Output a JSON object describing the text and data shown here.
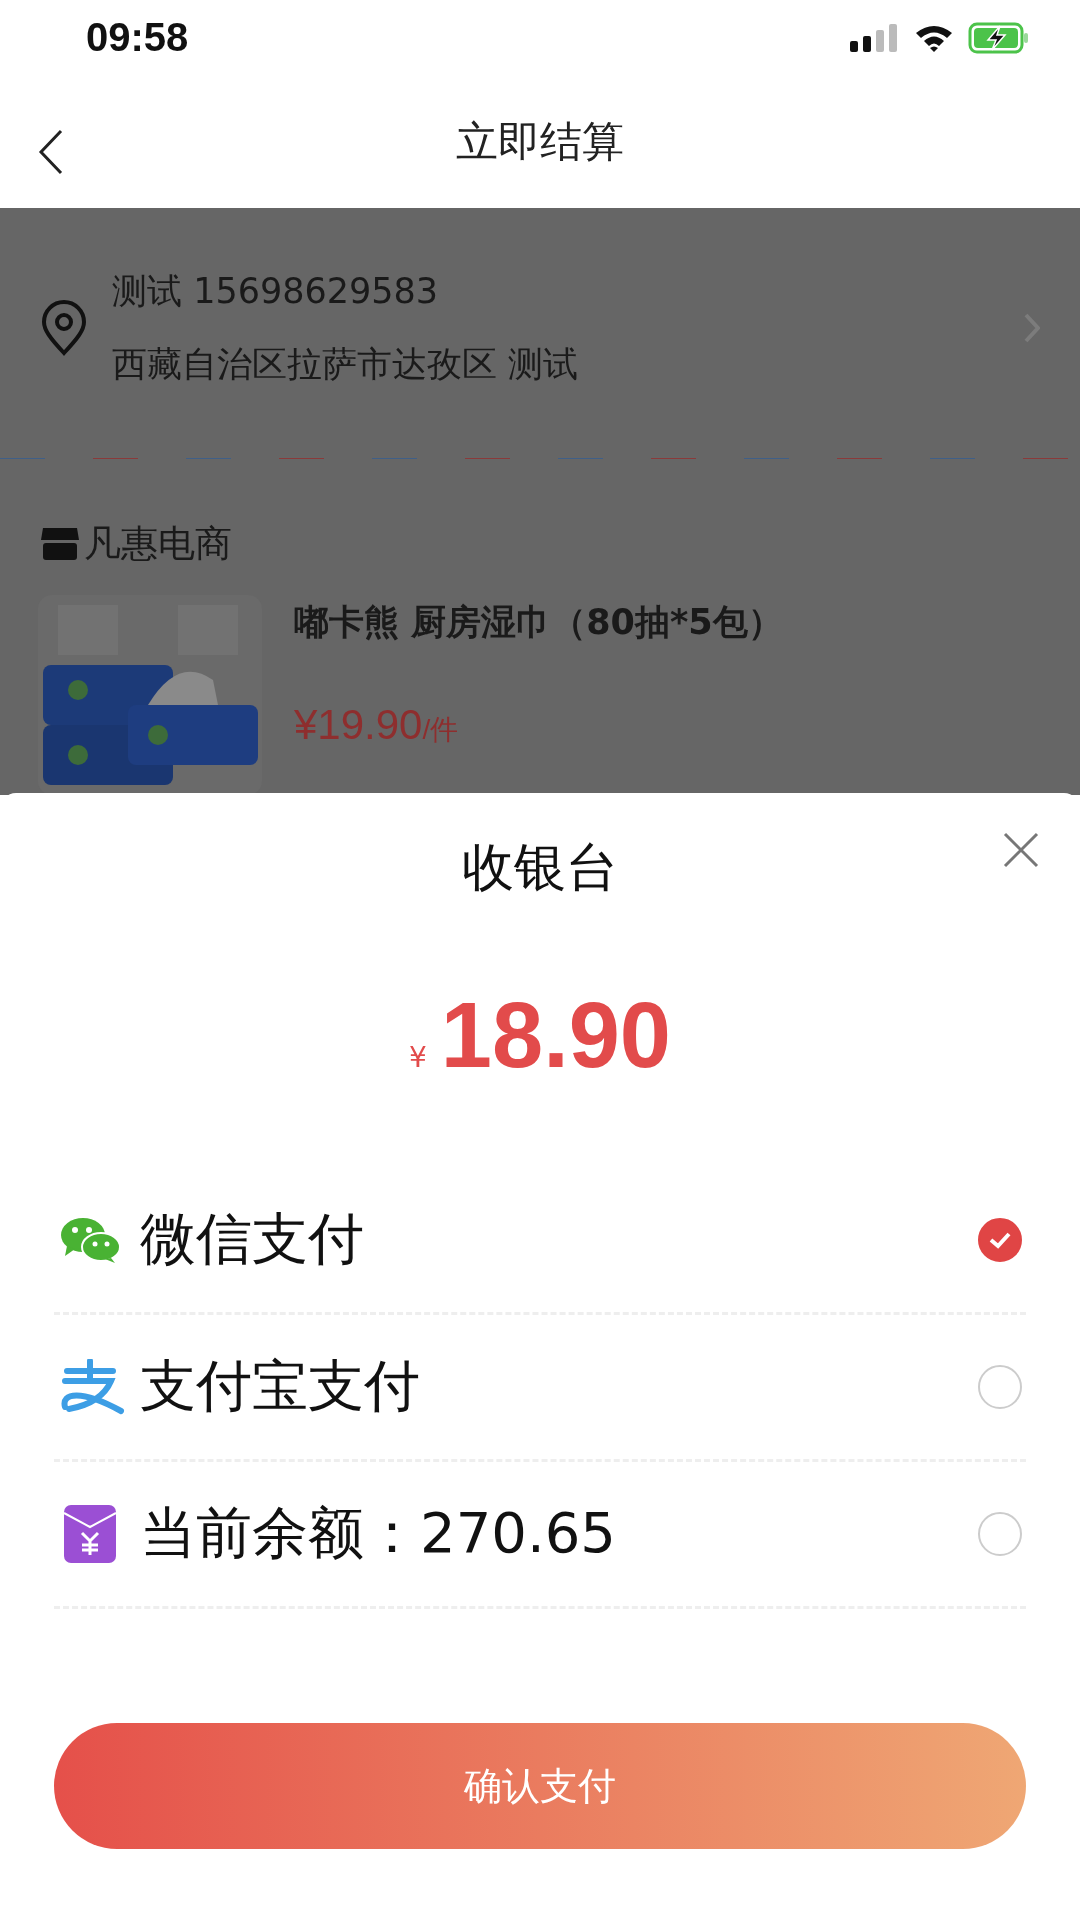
{
  "status_bar": {
    "time": "09:58"
  },
  "nav": {
    "title": "立即结算"
  },
  "address": {
    "contact": "测试 15698629583",
    "detail": "西藏自治区拉萨市达孜区 测试"
  },
  "shop": {
    "name": "凡惠电商"
  },
  "product": {
    "title": "嘟卡熊 厨房湿巾（80抽*5包）",
    "price": "¥19.90",
    "unit": "/件"
  },
  "cashier": {
    "title": "收银台",
    "currency": "¥",
    "amount": "18.90",
    "methods": [
      {
        "kind": "wechat",
        "label": "微信支付",
        "selected": true
      },
      {
        "kind": "alipay",
        "label": "支付宝支付",
        "selected": false
      },
      {
        "kind": "balance",
        "label": "当前余额：270.65",
        "selected": false
      }
    ],
    "confirm": "确认支付"
  }
}
